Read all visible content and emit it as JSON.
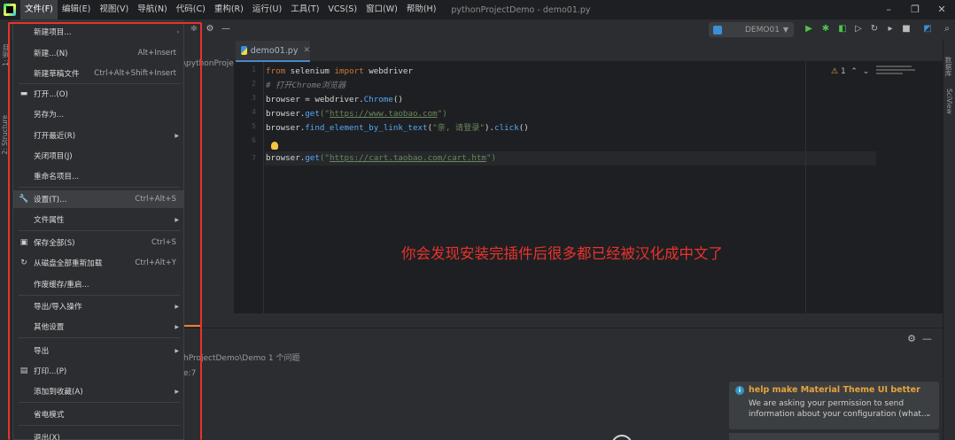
{
  "menubar": {
    "items": [
      "文件(F)",
      "编辑(E)",
      "视图(V)",
      "导航(N)",
      "代码(C)",
      "重构(R)",
      "运行(U)",
      "工具(T)",
      "VCS(S)",
      "窗口(W)",
      "帮助(H)"
    ],
    "window_title": "pythonProjectDemo - demo01.py"
  },
  "toolbar": {
    "run_config": "DEMO01"
  },
  "left_strip": {
    "project_tab": "1: 项目",
    "structure_tab": "2: Structure"
  },
  "right_strip": {
    "database_tab": "数据库",
    "sciview_tab": "SciView"
  },
  "project_panel": {
    "path_fragment": "\\pythonProje"
  },
  "editor": {
    "tab_label": "demo01.py",
    "line_numbers": [
      "1",
      "2",
      "3",
      "4",
      "5",
      "6",
      "7"
    ],
    "inspect": "1",
    "code": {
      "l1_kw1": "from",
      "l1_mod": " selenium ",
      "l1_kw2": "import",
      "l1_rest": " webdriver",
      "l2": "# 打开Chrome浏览器",
      "l3_a": "browser = webdriver.",
      "l3_fn": "Chrome",
      "l3_b": "()",
      "l4_a": "browser.",
      "l4_fn": "get",
      "l4_b": "(\"",
      "l4_url": "https://www.taobao.com",
      "l4_c": "\")",
      "l5_a": "browser.",
      "l5_fn": "find_element_by_link_text",
      "l5_b": "(",
      "l5_str": "\"亲, 请登录\"",
      "l5_c": ").",
      "l5_fn2": "click",
      "l5_d": "()",
      "l7_a": "browser.",
      "l7_fn": "get",
      "l7_b": "(\"",
      "l7_url": "https://cart.taobao.com/cart.htm",
      "l7_c": "\")"
    }
  },
  "annotation": "你会发现安装完插件后很多都已经被汉化成中文了",
  "bottom_panel": {
    "problems_text": "hProjectDemo\\Demo  1 个问题",
    "problems_sub": "e:7"
  },
  "notification": {
    "title": "help make Material Theme UI better",
    "body_line1": "We are asking your permission to send",
    "body_line2": "information about your configuration (what..."
  },
  "file_menu": {
    "items": [
      {
        "label": "新建项目...",
        "shortcut": "",
        "submenu": false,
        "icon": ""
      },
      {
        "label": "新建...(N)",
        "shortcut": "Alt+Insert",
        "submenu": false,
        "icon": ""
      },
      {
        "label": "新建草稿文件",
        "shortcut": "Ctrl+Alt+Shift+Insert",
        "submenu": false,
        "icon": ""
      },
      {
        "label": "打开...(O)",
        "shortcut": "",
        "submenu": false,
        "icon": "folder-icon"
      },
      {
        "label": "另存为...",
        "shortcut": "",
        "submenu": false,
        "icon": ""
      },
      {
        "label": "打开最近(R)",
        "shortcut": "",
        "submenu": true,
        "icon": ""
      },
      {
        "label": "关闭项目(J)",
        "shortcut": "",
        "submenu": false,
        "icon": ""
      },
      {
        "label": "重命名项目...",
        "shortcut": "",
        "submenu": false,
        "icon": ""
      },
      {
        "label": "设置(T)...",
        "shortcut": "Ctrl+Alt+S",
        "submenu": false,
        "icon": "wrench-icon"
      },
      {
        "label": "文件属性",
        "shortcut": "",
        "submenu": true,
        "icon": ""
      },
      {
        "label": "保存全部(S)",
        "shortcut": "Ctrl+S",
        "submenu": false,
        "icon": "save-icon"
      },
      {
        "label": "从磁盘全部重新加载",
        "shortcut": "Ctrl+Alt+Y",
        "submenu": false,
        "icon": "reload-icon"
      },
      {
        "label": "作废缓存/重启...",
        "shortcut": "",
        "submenu": false,
        "icon": ""
      },
      {
        "label": "导出/导入操作",
        "shortcut": "",
        "submenu": true,
        "icon": ""
      },
      {
        "label": "其他设置",
        "shortcut": "",
        "submenu": true,
        "icon": ""
      },
      {
        "label": "导出",
        "shortcut": "",
        "submenu": true,
        "icon": ""
      },
      {
        "label": "打印...(P)",
        "shortcut": "",
        "submenu": false,
        "icon": "print-icon"
      },
      {
        "label": "添加到收藏(A)",
        "shortcut": "",
        "submenu": true,
        "icon": ""
      },
      {
        "label": "省电模式",
        "shortcut": "",
        "submenu": false,
        "icon": ""
      },
      {
        "label": "退出(X)",
        "shortcut": "",
        "submenu": false,
        "icon": ""
      }
    ]
  },
  "colors": {
    "highlight_box": "#e8332c",
    "annotation": "#e8332c",
    "notification_title": "#e8a33d",
    "tab_underline": "#4a88c7"
  }
}
